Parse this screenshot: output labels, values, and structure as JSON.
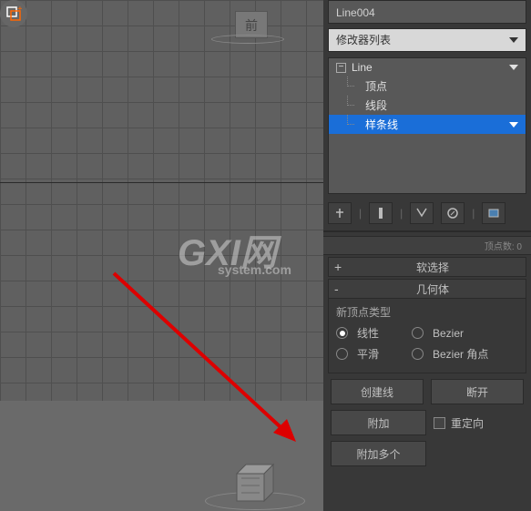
{
  "viewport": {
    "plane_label": "前"
  },
  "watermark": {
    "main": "GXI网",
    "sub": "system.com"
  },
  "object_name": "Line004",
  "modifier_dropdown": "修改器列表",
  "stack": {
    "root": "Line",
    "items": [
      "顶点",
      "线段",
      "样条线"
    ],
    "selected_index": 2
  },
  "status_text": "顶点数: 0",
  "rollouts": {
    "soft_selection": {
      "sign": "+",
      "title": "软选择"
    },
    "geometry": {
      "sign": "-",
      "title": "几何体"
    }
  },
  "geometry": {
    "vertex_type_label": "新顶点类型",
    "radio_linear": "线性",
    "radio_bezier": "Bezier",
    "radio_smooth": "平滑",
    "radio_bezier_corner": "Bezier 角点",
    "btn_create_line": "创建线",
    "btn_break": "断开",
    "btn_attach": "附加",
    "btn_attach_mult": "附加多个",
    "check_reorient": "重定向"
  }
}
